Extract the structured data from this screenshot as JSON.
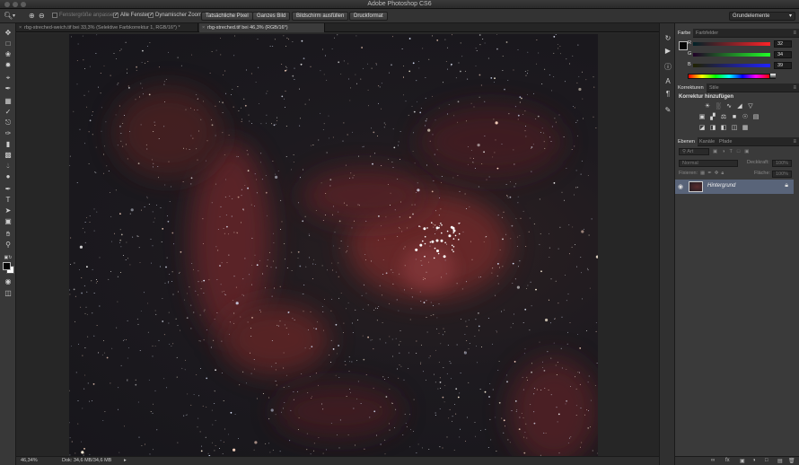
{
  "app": {
    "title": "Adobe Photoshop CS6"
  },
  "options_bar": {
    "zoom_icon": "zoom-icon",
    "checkbox_resize_windows": "Fenstergröße anpassen",
    "checkbox_all_windows": "Alle Fenster",
    "checkbox_scrubby_zoom": "Dynamischer Zoom",
    "btn_actual_pixels": "Tatsächliche Pixel",
    "btn_fit_screen": "Ganzes Bild",
    "btn_fill_screen": "Bildschirm ausfüllen",
    "btn_print_size": "Druckformat",
    "workspace": "Grundelemente"
  },
  "doc_tabs": [
    {
      "label": "rbg-streched-weich.tif bei 33,3% (Selektive Farbkorrektur 1, RGB/16*) *"
    },
    {
      "label": "rbg-streched.tif bei 46,3% (RGB/16*)"
    }
  ],
  "status_bar": {
    "zoom": "46,34%",
    "doc_size": "Dok: 34,6 MB/34,6 MB"
  },
  "color_panel": {
    "tabs": [
      "Farbe",
      "Farbfelder"
    ],
    "r_label": "R",
    "g_label": "G",
    "b_label": "B",
    "r_value": "32",
    "g_value": "34",
    "b_value": "39"
  },
  "adjustments_panel": {
    "tabs": [
      "Korrekturen",
      "Stile"
    ],
    "title": "Korrektur hinzufügen"
  },
  "layers_panel": {
    "tabs": [
      "Ebenen",
      "Kanäle",
      "Pfade"
    ],
    "filter_label": "Art",
    "blend_mode": "Normal",
    "opacity_label": "Deckkraft:",
    "opacity_value": "100%",
    "lock_label": "Fixieren:",
    "fill_label": "Fläche:",
    "fill_value": "100%",
    "layers": [
      {
        "name": "Hintergrund"
      }
    ]
  },
  "colors": {
    "foreground": "#050505",
    "background": "#ffffff",
    "selected_layer": "#596479",
    "nebula": "#8a2e2e"
  }
}
